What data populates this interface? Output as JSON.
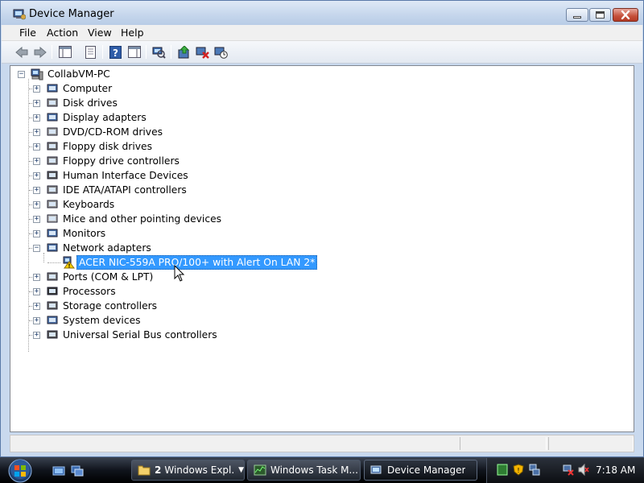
{
  "window": {
    "title": "Device Manager"
  },
  "menu": [
    "File",
    "Action",
    "View",
    "Help"
  ],
  "toolbar_icons": [
    "back-icon",
    "forward-icon",
    "show-hide-tree-icon",
    "properties-icon",
    "help-icon",
    "action-pane-icon",
    "scan-hardware-icon",
    "update-driver-icon",
    "uninstall-icon",
    "disable-icon"
  ],
  "tree": {
    "root": "CollabVM-PC",
    "categories": [
      "Computer",
      "Disk drives",
      "Display adapters",
      "DVD/CD-ROM drives",
      "Floppy disk drives",
      "Floppy drive controllers",
      "Human Interface Devices",
      "IDE ATA/ATAPI controllers",
      "Keyboards",
      "Mice and other pointing devices",
      "Monitors",
      "Network adapters",
      "Ports (COM & LPT)",
      "Processors",
      "Storage controllers",
      "System devices",
      "Universal Serial Bus controllers"
    ],
    "network_child": "ACER NIC-559A PRO/100+ with Alert On LAN 2*"
  },
  "taskbar": {
    "tasks": [
      {
        "count": "2",
        "label": "Windows Expl..."
      },
      {
        "label": "Windows Task M..."
      },
      {
        "label": "Device Manager"
      }
    ],
    "clock": "7:18 AM"
  },
  "colors": {
    "selection": "#3399ff",
    "close_button": "#c5503a",
    "taskbar": "#10141c"
  }
}
